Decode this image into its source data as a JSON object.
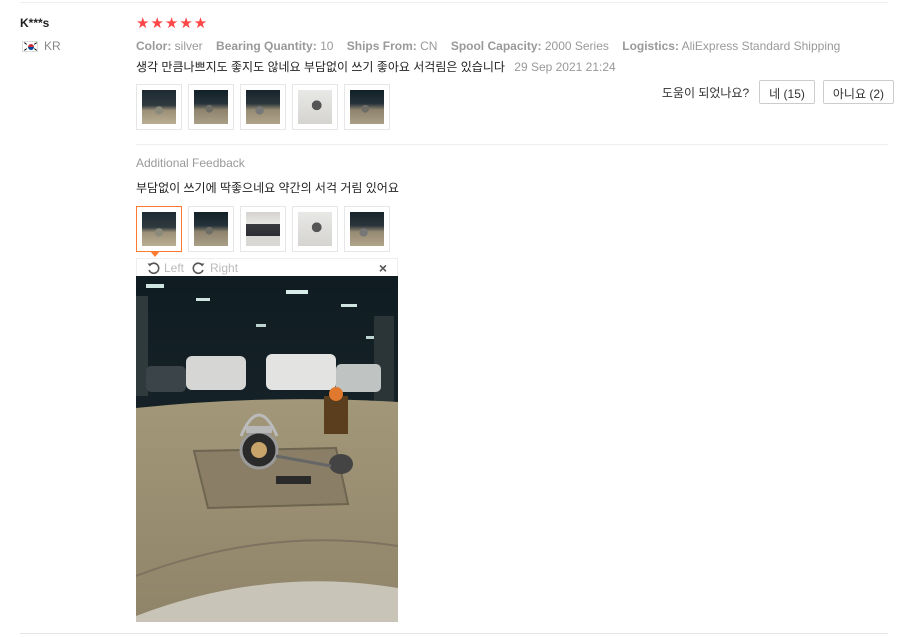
{
  "review": {
    "user_name": "K***s",
    "country": "KR",
    "stars": "★★★★★",
    "attributes": [
      {
        "key": "Color:",
        "value": "silver"
      },
      {
        "key": "Bearing Quantity:",
        "value": "10"
      },
      {
        "key": "Ships From:",
        "value": "CN"
      },
      {
        "key": "Spool Capacity:",
        "value": "2000 Series"
      },
      {
        "key": "Logistics:",
        "value": "AliExpress Standard Shipping"
      }
    ],
    "text": "생각 만큼나쁘지도 좋지도 않네요 부담없이 쓰기 좋아요 서걱림은 있습니다",
    "date": "29 Sep 2021 21:24"
  },
  "helpful": {
    "label": "도움이 되었나요?",
    "yes": "네 (15)",
    "no": "아니요 (2)"
  },
  "additional": {
    "title": "Additional Feedback",
    "text": "부담없이 쓰기에 딱좋으네요 약간의 서걱 거림 있어요"
  },
  "viewer": {
    "rotate_left": "Left",
    "rotate_right": "Right",
    "close": "×"
  },
  "colors": {
    "star": "#ff4747",
    "active_thumb": "#ff7a2f"
  }
}
